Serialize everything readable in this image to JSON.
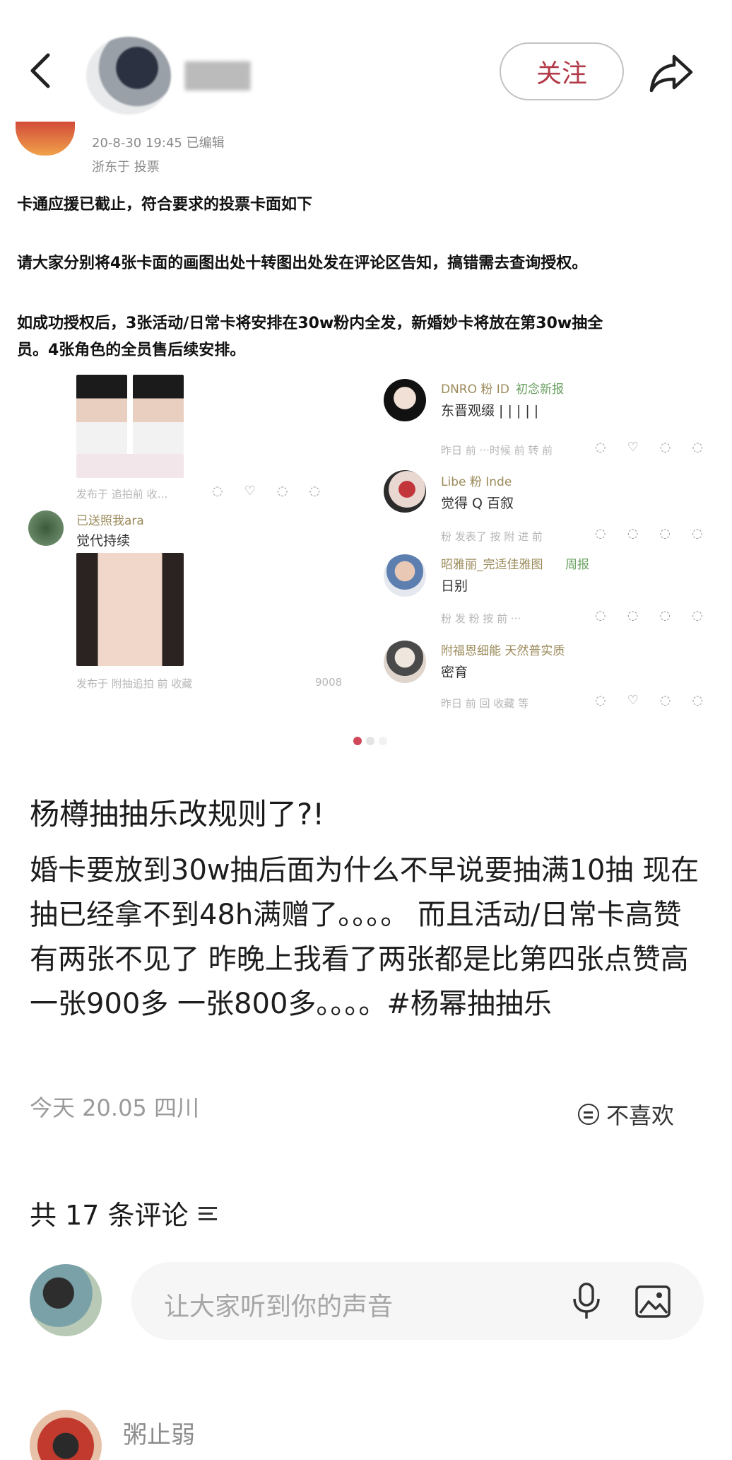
{
  "header": {
    "follow_label": "关注"
  },
  "shot": {
    "meta_line": "20-8-30 19:45  已编辑",
    "meta_sub": "浙东于 投票",
    "para1": "卡通应援已截止，符合要求的投票卡面如下",
    "para2": "请大家分别将4张卡面的画图出处十转图出处发在评论区告知，搞错需去查询授权。",
    "para3a": "如成功授权后，3张活动/日常卡将安排在30w粉内全发，新婚妙卡将放在第30w抽全",
    "para3b": "员。4张角色的全员售后续安排。",
    "left_meta_1": "发布于 追拍前 收…",
    "left_name": "已送照我ara",
    "left_text": "觉代持续",
    "left_meta_2": "发布于 附抽追拍 前  收藏",
    "left_count": "9008",
    "comments": [
      {
        "name": "DNRO 粉 ID",
        "tag": "初念新报",
        "text": "东晋观缀 | | | | |",
        "meta": "昨日 前 ···时候 前 转  前"
      },
      {
        "name": "Libe 粉 Inde",
        "tag": "",
        "text": "觉得 Q 百叙",
        "meta": "粉 发表了 按 附 进 前"
      },
      {
        "name": "昭雅丽_完适佳雅图",
        "tag": "周报",
        "text": "日别",
        "meta": "粉 发 粉 按 前 ···"
      },
      {
        "name": "附福恩细能 天然普实质",
        "tag": "",
        "text": "密育",
        "meta": "昨日 前 回 收藏 等"
      }
    ]
  },
  "post": {
    "title": "杨樽抽抽乐改规则了?!",
    "body": "婚卡要放到30w抽后面为什么不早说要抽满10抽 现在抽已经拿不到48h满赠了。。。。 而且活动/日常卡高赞有两张不见了 昨晚上我看了两张都是比第四张点赞高 一张900多 一张800多。。。。#杨幂抽抽乐",
    "meta": "今天 20.05 四川",
    "dislike_label": "不喜欢"
  },
  "comments_section": {
    "count_label": "共 17 条评论",
    "input_placeholder": "让大家听到你的声音",
    "first_commenter": "粥止弱"
  },
  "colors": {
    "accent": "#b23a48",
    "indicator_active": "#d0485a"
  },
  "icons": [
    "back-arrow-icon",
    "share-icon",
    "dislike-icon",
    "sort-icon",
    "microphone-icon",
    "image-icon"
  ]
}
